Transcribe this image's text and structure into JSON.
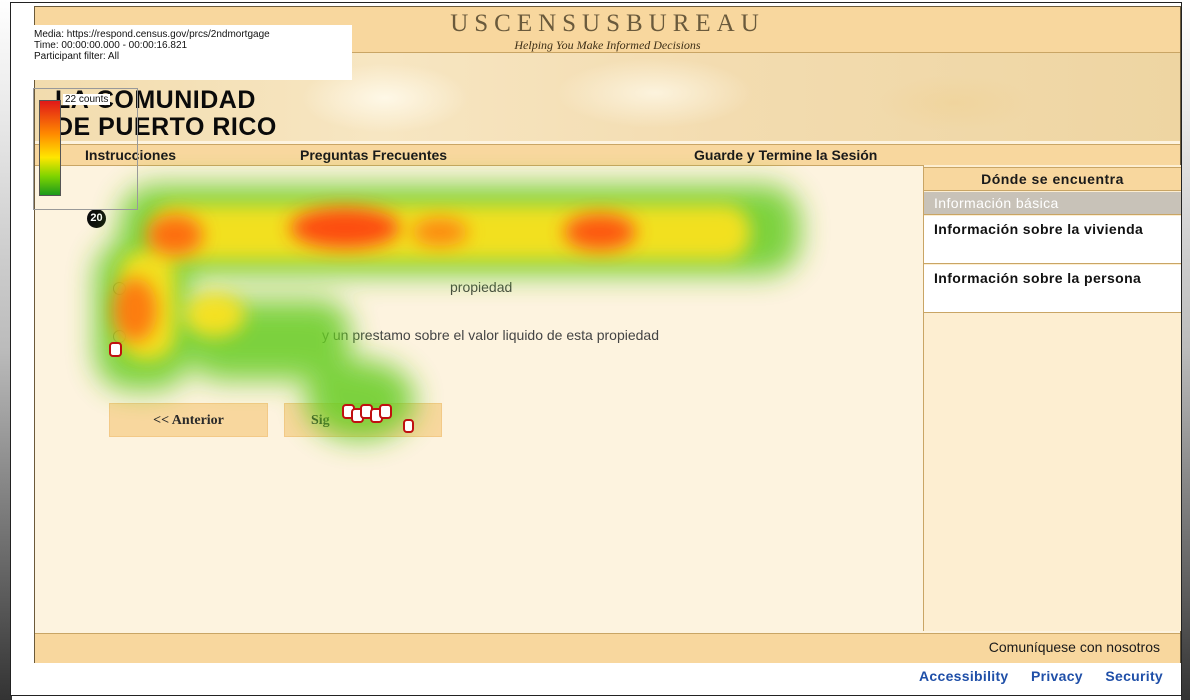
{
  "overlay": {
    "media": "Media: https://respond.census.gov/prcs/2ndmortgage",
    "time": "Time: 00:00:00.000 - 00:00:16.821",
    "participant_filter": "Participant filter: All",
    "legend_count": "22 counts"
  },
  "header": {
    "agency": "USCENSUSBUREAU",
    "tagline": "Helping You Make Informed Decisions",
    "region_line1": "LA COMUNIDAD",
    "region_line2": "DE PUERTO RICO"
  },
  "nav": {
    "instructions": "Instrucciones",
    "faq": "Preguntas Frecuentes",
    "save_exit": "Guarde y Termine la Sesión"
  },
  "question": {
    "number": "20",
    "option_a": "propiedad",
    "option_c": "y un prestamo sobre el valor liquido de esta propiedad"
  },
  "buttons": {
    "previous": "<<   Anterior",
    "next": "Sig"
  },
  "sidebar": {
    "header": "Dónde se encuentra",
    "items": [
      {
        "label": "Información básica",
        "state": "disabled"
      },
      {
        "label": "Información sobre la vivienda",
        "state": "active"
      },
      {
        "label": "Información sobre la persona",
        "state": "active"
      }
    ]
  },
  "footer": {
    "contact": "Comuníquese con nosotros",
    "links": [
      "Accessibility",
      "Privacy",
      "Security"
    ]
  },
  "colors": {
    "banner": "#f8d79e",
    "page_bg": "#fdf3df",
    "link_blue": "#1f4fa8",
    "heat_high": "#e01818",
    "heat_low": "#7fd400"
  }
}
